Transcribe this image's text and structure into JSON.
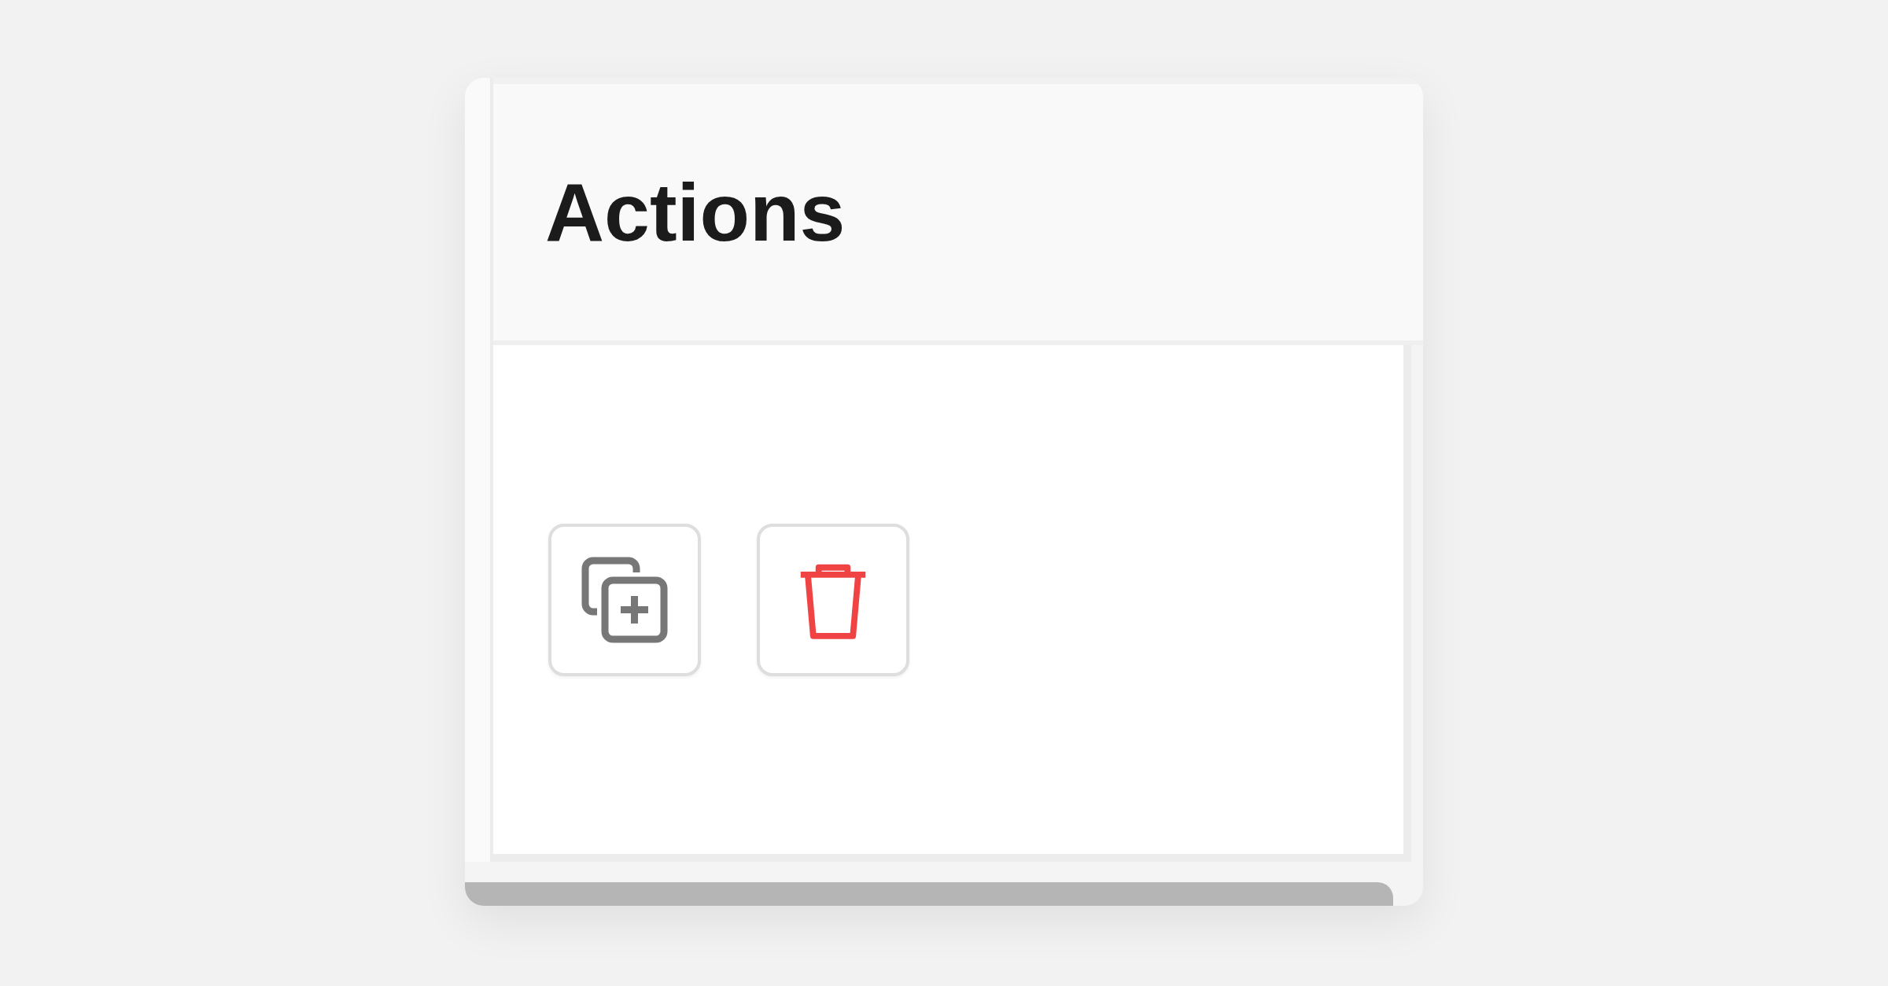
{
  "header": {
    "title": "Actions"
  },
  "actions": [
    {
      "kind": "duplicate"
    },
    {
      "kind": "delete"
    }
  ]
}
